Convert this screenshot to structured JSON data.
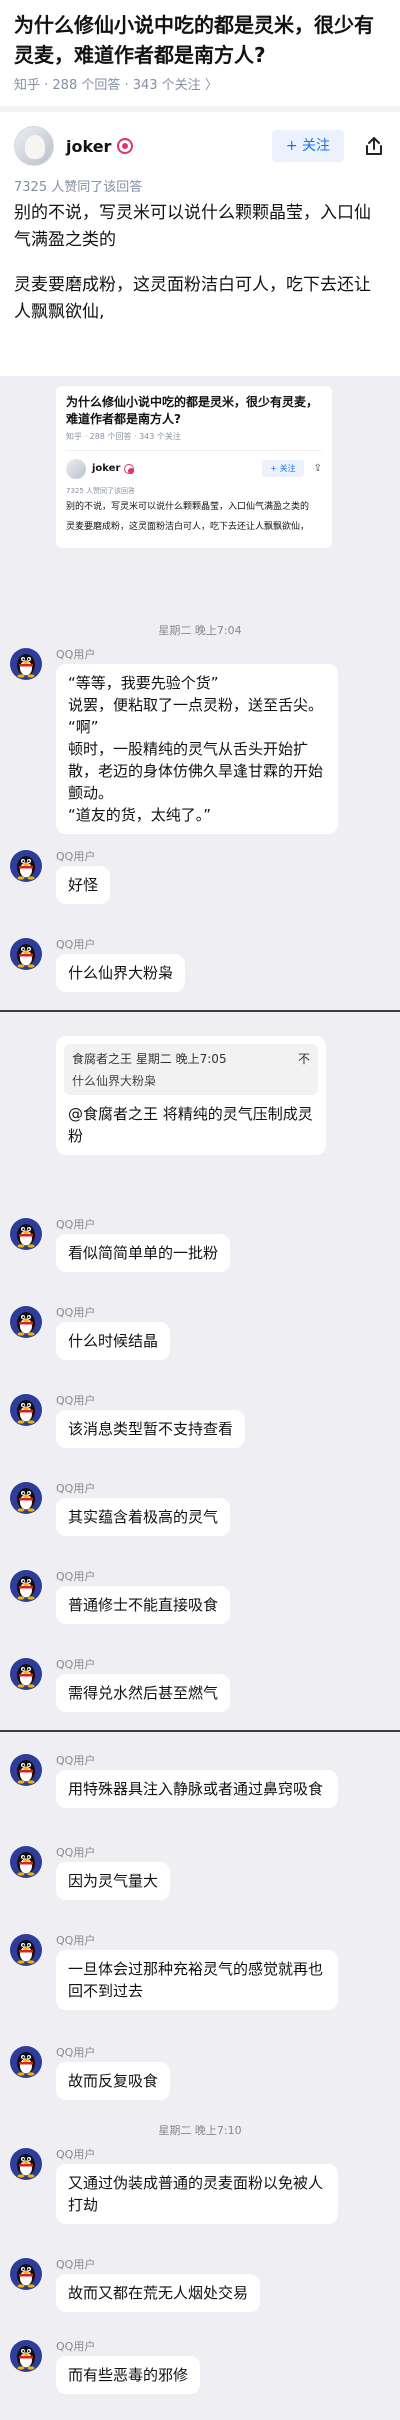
{
  "question": {
    "title": "为什么修仙小说中吃的都是灵米，很少有灵麦，难道作者都是南方人?",
    "meta": "知乎 · 288 个回答 · 343 个关注 〉"
  },
  "author": {
    "name": "joker",
    "follow_label": "+ 关注",
    "approve_text": "7325 人赞同了该回答"
  },
  "answer": {
    "paragraphs": [
      "别的不说，写灵米可以说什么颗颗晶莹，入口仙气满盈之类的",
      "灵麦要磨成粉，这灵面粉洁白可人，吃下去还让人飘飘欲仙,"
    ]
  },
  "quote_card": {
    "title": "为什么修仙小说中吃的都是灵米，很少有灵麦，难道作者都是南方人?",
    "meta": "知乎 · 288 个回答 · 343 个关注",
    "name": "joker",
    "follow_label": "+ 关注",
    "approve_text": "7325 人赞同了该回答",
    "p1": "别的不说，写灵米可以说什么颗颗晶莹，入口仙气满盈之类的",
    "p2": "灵麦要磨成粉，这灵面粉洁白可人，吃下去还让人飘飘欲仙，"
  },
  "chat": {
    "timestamps": [
      "星期二 晚上7:04",
      "星期二 晚上7:10"
    ],
    "sender": "QQ用户",
    "messages": [
      "“等等，我要先验个货”\n说罢，便粘取了一点灵粉，送至舌尖。\n“啊”\n顿时，一股精纯的灵气从舌头开始扩散，老迈的身体仿佛久旱逢甘霖的开始颤动。\n“道友的货，太纯了。”",
      "好怪",
      "什么仙界大粉枭",
      "看似简简单单的一批粉",
      "什么时候结晶",
      "该消息类型暂不支持查看",
      "其实蕴含着极高的灵气",
      "普通修士不能直接吸食",
      "需得兑水然后甚至燃气",
      "用特殊器具注入静脉或者通过鼻窍吸食",
      "因为灵气量大",
      "一旦体会过那种充裕灵气的感觉就再也回不到过去",
      "故而反复吸食",
      "又通过伪装成普通的灵麦面粉以免被人打劫",
      "故而又都在荒无人烟处交易",
      "而有些恶毒的邪修"
    ],
    "reply": {
      "quoted_head": "食腐者之王 星期二 晚上7:05",
      "quoted_text": "什么仙界大粉枭",
      "close": "不",
      "text": "@食腐者之王 将精纯的灵气压制成灵粉"
    }
  }
}
